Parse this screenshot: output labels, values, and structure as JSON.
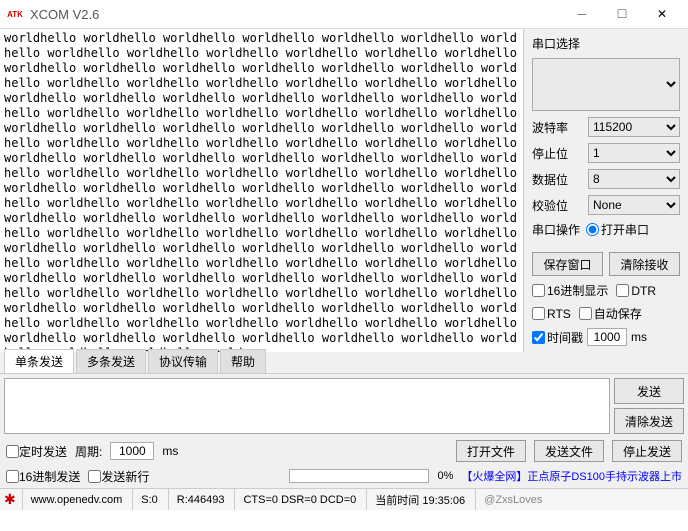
{
  "window": {
    "title": "XCOM V2.6",
    "logo": "ATK"
  },
  "terminal_text": "worldhello worldhello worldhello worldhello worldhello worldhello worldhello worldhello worldhello worldhello worldhello worldhello worldhello worldhello worldhello worldhello worldhello worldhello worldhello worldhello worldhello worldhello worldhello worldhello worldhello worldhello worldhello worldhello worldhello worldhello worldhello worldhello worldhello worldhello worldhello worldhello worldhello worldhello worldhello worldhello worldhello worldhello worldhello worldhello worldhello worldhello worldhello worldhello worldhello worldhello worldhello worldhello worldhello worldhello worldhello worldhello worldhello worldhello worldhello worldhello worldhello worldhello worldhello worldhello worldhello worldhello worldhello worldhello worldhello worldhello worldhello worldhello worldhello worldhello worldhello worldhello worldhello worldhello worldhello worldhello worldhello worldhello worldhello worldhello worldhello worldhello worldhello worldhello worldhello worldhello worldhello worldhello worldhello worldhello worldhello worldhello worldhello worldhello worldhello worldhello worldhello worldhello worldhello worldhello worldhello worldhello worldhello worldhello worldhello worldhello worldhello worldhello worldhello worldhello worldhello worldhello worldhello worldhello worldhello worldhello worldhello worldhello worldhello worldhello worldhello worldhello worldhello worldhello worldhello worldhello worldhello worldhello worldhello worldhello worldhello worldhello worldhello worldhello worldhello world",
  "panel": {
    "port_select_label": "串口选择",
    "baud_label": "波特率",
    "baud_value": "115200",
    "stop_label": "停止位",
    "stop_value": "1",
    "data_label": "数据位",
    "data_value": "8",
    "parity_label": "校验位",
    "parity_value": "None",
    "op_label": "串口操作",
    "open_label": "打开串口",
    "save_win": "保存窗口",
    "clear_recv": "清除接收",
    "hex_disp": "16进制显示",
    "dtr": "DTR",
    "rts": "RTS",
    "auto_save": "自动保存",
    "timestamp": "时间戳",
    "timestamp_val": "1000",
    "ms": "ms"
  },
  "tabs": [
    "单条发送",
    "多条发送",
    "协议传输",
    "帮助"
  ],
  "send": {
    "button": "发送",
    "clear": "清除发送"
  },
  "ctrl": {
    "timed_send": "定时发送",
    "period_label": "周期:",
    "period_val": "1000",
    "ms": "ms",
    "open_file": "打开文件",
    "send_file": "发送文件",
    "stop_send": "停止发送",
    "hex_send": "16进制发送",
    "send_newline": "发送新行",
    "progress_pct": "0%",
    "promo_hot": "【火爆全网】",
    "promo_rest": "正点原子DS100手持示波器上市"
  },
  "status": {
    "url": "www.openedv.com",
    "s": "S:0",
    "r": "R:446493",
    "cts": "CTS=0 DSR=0 DCD=0",
    "time_label": "当前时间 19:35:06",
    "watermark": "@ZxsLoves"
  }
}
